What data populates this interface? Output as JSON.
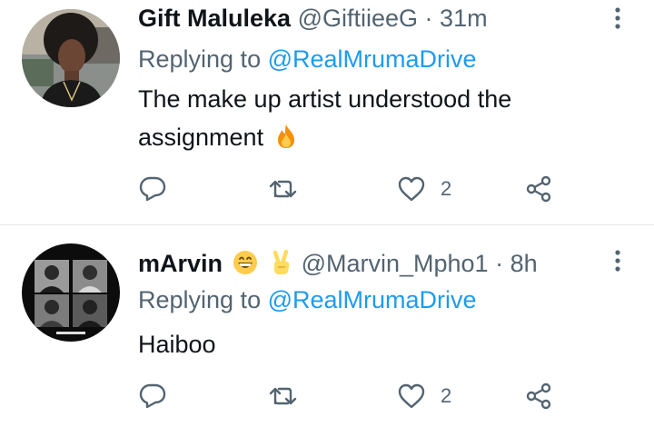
{
  "tweets": [
    {
      "name": "Gift Maluleka",
      "handle": "@GiftiieeG",
      "separator": "·",
      "time": "31m",
      "replying_prefix": "Replying to ",
      "replying_to": "@RealMrumaDrive",
      "text": "The make up artist understood the assignment",
      "text_emoji": "fire",
      "like_count": "2",
      "avatar_icon": "profile-photo"
    },
    {
      "name": "mArvin",
      "name_emojis": [
        "grinning-face",
        "victory-hand"
      ],
      "handle": "@Marvin_Mpho1",
      "separator": "·",
      "time": "8h",
      "replying_prefix": "Replying to ",
      "replying_to": "@RealMrumaDrive",
      "text": "Haiboo",
      "like_count": "2",
      "avatar_icon": "album-art-photo"
    }
  ],
  "colors": {
    "text": "#0f1419",
    "secondary": "#536471",
    "link": "#1d9bf0",
    "divider": "#e7e9ea"
  }
}
